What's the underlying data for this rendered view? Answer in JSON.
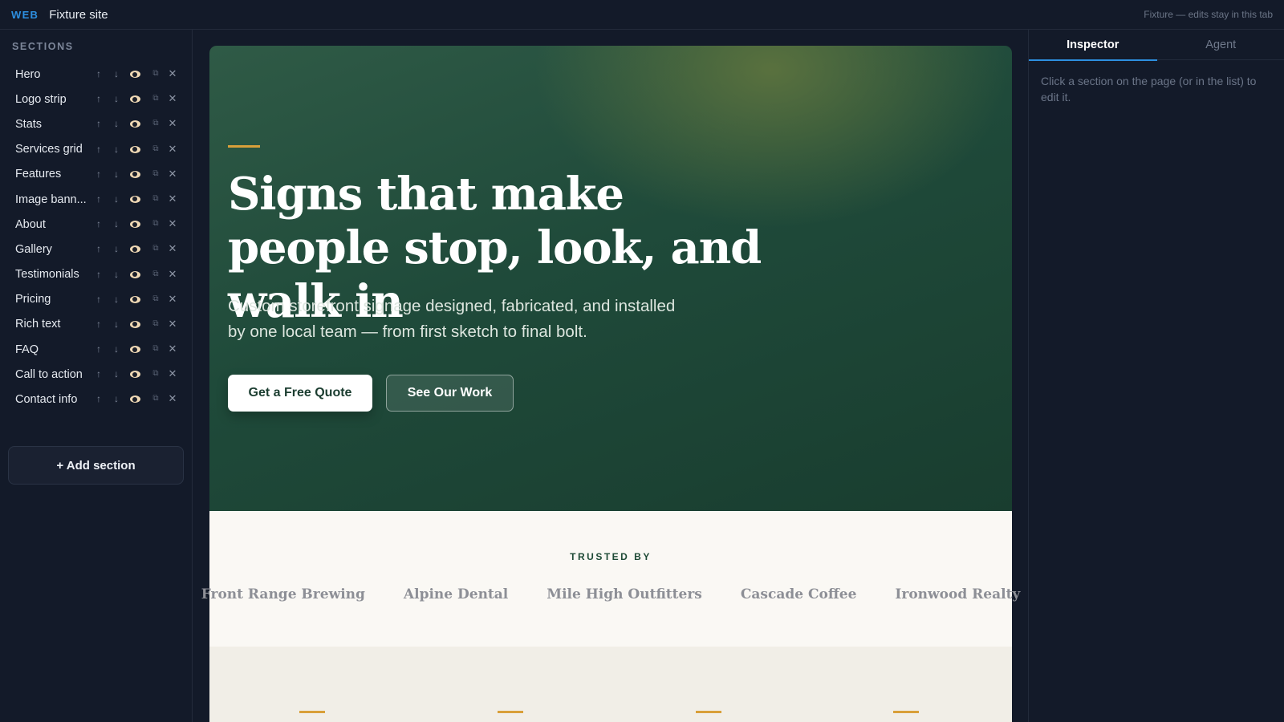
{
  "topbar": {
    "brand": "WEB",
    "site_name": "Fixture site",
    "note": "Fixture — edits stay in this tab"
  },
  "sidebar": {
    "heading": "SECTIONS",
    "sections": [
      {
        "label": "Hero"
      },
      {
        "label": "Logo strip"
      },
      {
        "label": "Stats"
      },
      {
        "label": "Services grid"
      },
      {
        "label": "Features"
      },
      {
        "label": "Image bann..."
      },
      {
        "label": "About"
      },
      {
        "label": "Gallery"
      },
      {
        "label": "Testimonials"
      },
      {
        "label": "Pricing"
      },
      {
        "label": "Rich text"
      },
      {
        "label": "FAQ"
      },
      {
        "label": "Call to action"
      },
      {
        "label": "Contact info"
      }
    ],
    "row_controls": {
      "up": "↑",
      "down": "↓",
      "duplicate": "⧉",
      "delete": "✕"
    },
    "add_section_label": "+ Add section"
  },
  "hero": {
    "title": "Signs that make people stop, look, and walk in",
    "subtitle": "Custom storefront signage designed, fabricated, and installed by one local team — from first sketch to final bolt.",
    "primary_button": "Get a Free Quote",
    "secondary_button": "See Our Work"
  },
  "logo_strip": {
    "eyebrow": "TRUSTED BY",
    "logos": [
      "Front Range Brewing",
      "Alpine Dental",
      "Mile High Outfitters",
      "Cascade Coffee",
      "Ironwood Realty"
    ]
  },
  "inspector": {
    "tabs": [
      {
        "label": "Inspector",
        "active": true
      },
      {
        "label": "Agent",
        "active": false
      }
    ],
    "hint": "Click a section on the page (or in the list) to edit it."
  },
  "colors": {
    "accent_blue": "#2d8fe0",
    "accent_gold": "#d9a03a",
    "hero_green": "#1f4a3a",
    "app_background": "#131a29"
  },
  "icons": [
    "arrow-up-icon",
    "arrow-down-icon",
    "eye-icon",
    "duplicate-icon",
    "close-icon"
  ]
}
